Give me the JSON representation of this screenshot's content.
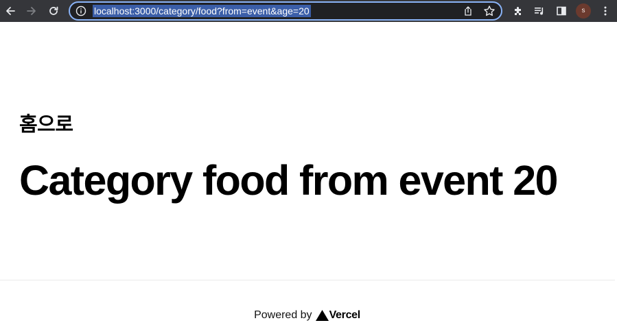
{
  "browser": {
    "url": "localhost:3000/category/food?from=event&age=20",
    "profile_initial": "s",
    "icons": {
      "back": "arrow-left-icon",
      "forward": "arrow-right-icon",
      "reload": "reload-icon",
      "site_info": "info-icon",
      "share": "share-icon",
      "bookmark": "star-icon",
      "extensions": "puzzle-icon",
      "media": "media-queue-icon",
      "side_panel": "side-panel-icon",
      "menu": "kebab-menu-icon"
    },
    "colors": {
      "toolbar_bg": "#35363a",
      "omnibox_bg": "#202124",
      "focus_ring": "#8ab4f8",
      "url_selection": "#3b5ea8",
      "avatar_bg": "#6b3a2e"
    }
  },
  "page": {
    "home_link": "홈으로",
    "title": "Category food from event 20"
  },
  "footer": {
    "powered_by": "Powered by",
    "brand": "Vercel"
  }
}
